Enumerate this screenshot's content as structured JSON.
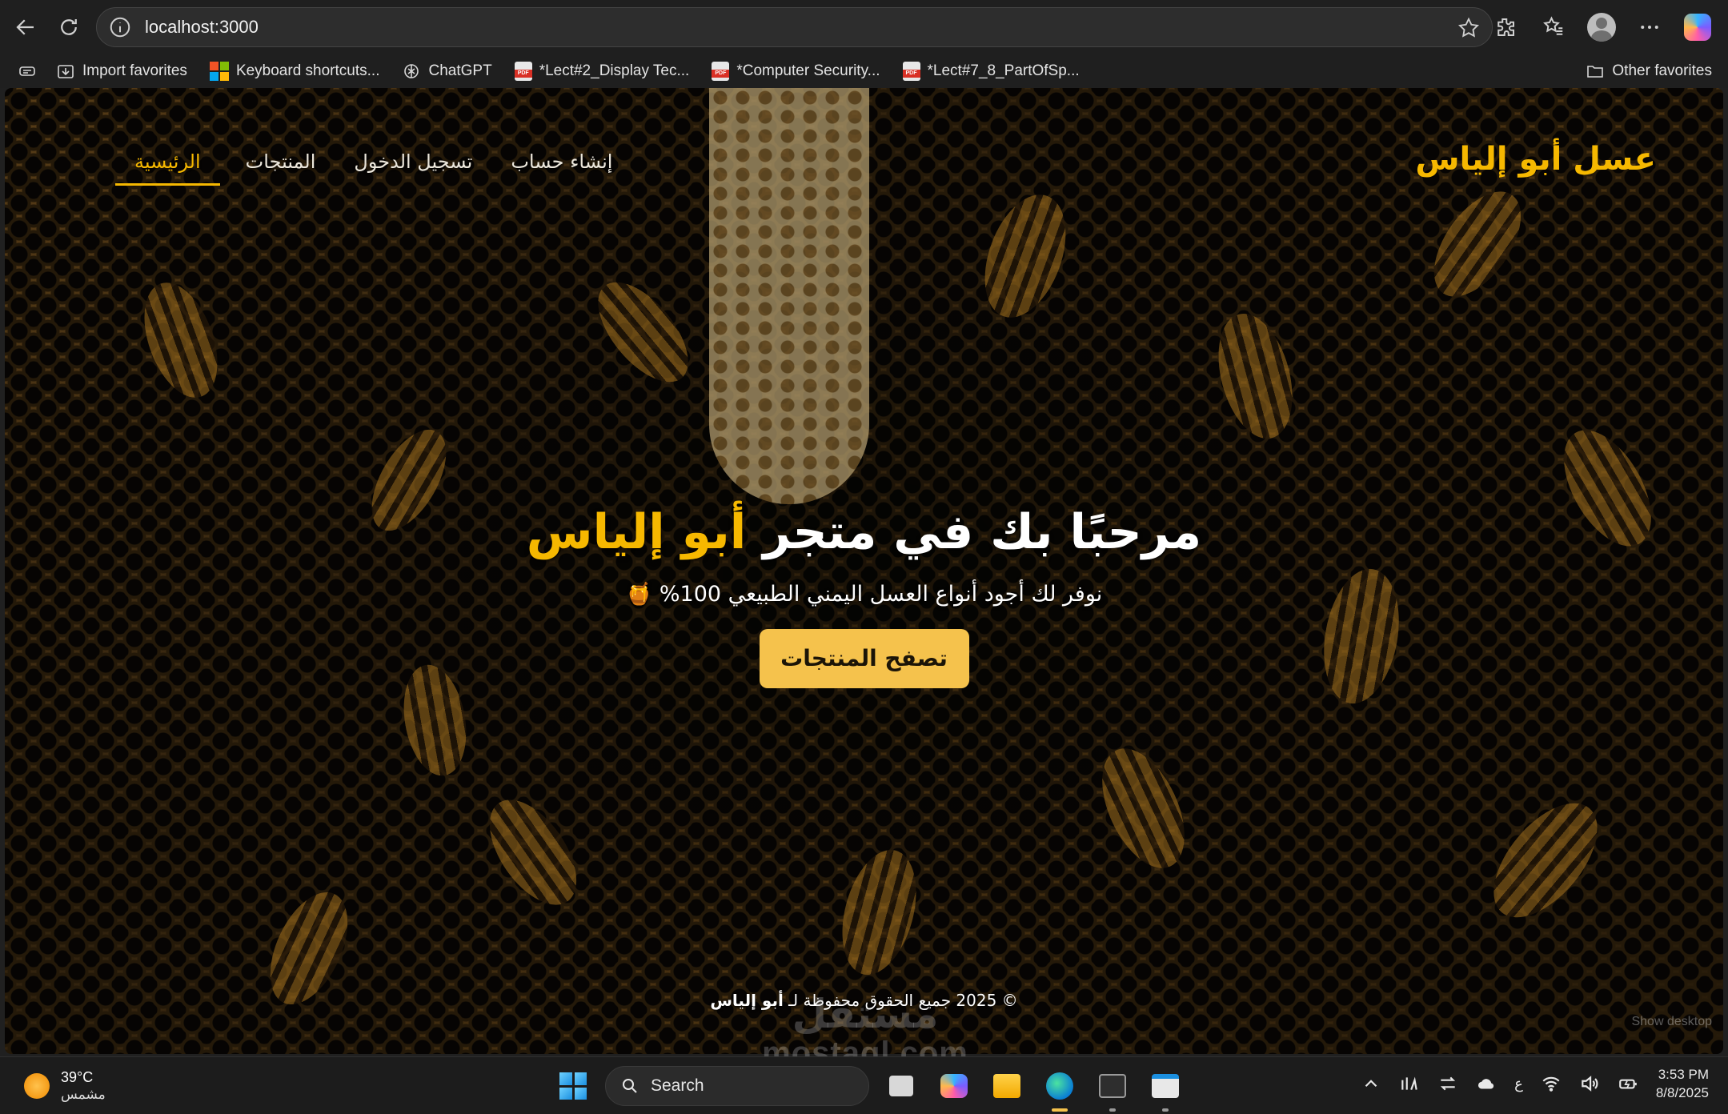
{
  "browser": {
    "url": "localhost:3000",
    "bookmarks": [
      {
        "label": "Import favorites",
        "icon": "import-icon"
      },
      {
        "label": "Keyboard shortcuts...",
        "icon": "microsoft-icon"
      },
      {
        "label": "ChatGPT",
        "icon": "chatgpt-icon"
      },
      {
        "label": "*Lect#2_Display Tec...",
        "icon": "pdf-icon"
      },
      {
        "label": "*Computer Security...",
        "icon": "pdf-icon"
      },
      {
        "label": "*Lect#7_8_PartOfSp...",
        "icon": "pdf-icon"
      }
    ],
    "other_favorites": "Other favorites"
  },
  "site": {
    "logo": "عسل أبو إلياس",
    "nav": [
      {
        "label": "الرئيسية",
        "active": true
      },
      {
        "label": "المنتجات",
        "active": false
      },
      {
        "label": "تسجيل الدخول",
        "active": false
      },
      {
        "label": "إنشاء حساب",
        "active": false
      }
    ],
    "hero": {
      "title_main": "مرحبًا بك في متجر ",
      "title_accent": "أبو إلياس",
      "subtitle": "نوفر لك أجود أنواع العسل اليمني الطبيعي 100% 🍯",
      "cta": "تصفح المنتجات"
    },
    "footer": {
      "text": "© 2025 جميع الحقوق محفوظة لـ ",
      "brand": "أبو إلياس"
    },
    "accent_color": "#f6b800",
    "button_color": "#f5c24c"
  },
  "overlay": {
    "show_desktop": "Show desktop",
    "watermark_ar": "مستقل",
    "watermark_en": "mostaql.com"
  },
  "taskbar": {
    "temperature": "39°C",
    "condition": "مشمس",
    "search": "Search",
    "time": "3:53 PM",
    "date": "8/8/2025",
    "input_lang": "ع"
  }
}
